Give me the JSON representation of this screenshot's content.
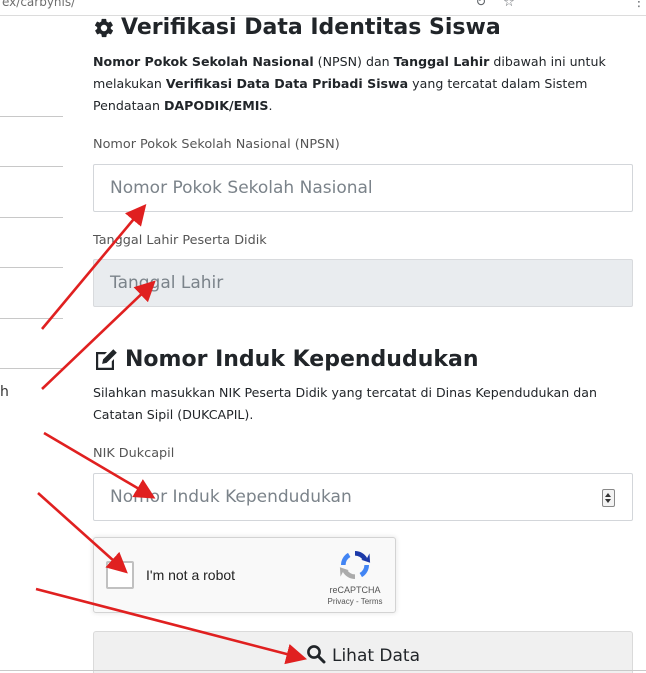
{
  "browser": {
    "url_fragment": "ex/carbynis/"
  },
  "sidebar": {
    "text_fragment": "h"
  },
  "verification": {
    "title": "Verifikasi Data Identitas Siswa",
    "title_icon": "gear-icon",
    "intro": {
      "npsn_bold": "Nomor Pokok Sekolah Nasional",
      "npsn_abbr": "(NPSN)",
      "and_text": "dan",
      "dob_bold": "Tanggal Lahir",
      "middle_text": "dibawah ini untuk melakukan",
      "verify_bold": "Verifikasi Data Data Pribadi Siswa",
      "tail_text": "yang tercatat dalam Sistem Pendataan",
      "system_bold": "DAPODIK/EMIS",
      "end": "."
    },
    "npsn_label": "Nomor Pokok Sekolah Nasional (NPSN)",
    "npsn_placeholder": "Nomor Pokok Sekolah Nasional",
    "dob_label": "Tanggal Lahir Peserta Didik",
    "dob_placeholder": "Tanggal Lahir"
  },
  "nik": {
    "title": "Nomor Induk Kependudukan",
    "title_icon": "edit-icon",
    "intro": "Silahkan masukkan NIK Peserta Didik yang tercatat di Dinas Kependudukan dan Catatan Sipil (DUKCAPIL).",
    "label": "NIK Dukcapil",
    "placeholder": "Nomor Induk Kependudukan"
  },
  "recaptcha": {
    "checkbox_label": "I'm not a robot",
    "brand": "reCAPTCHA",
    "privacy": "Privacy",
    "separator": "-",
    "terms": "Terms"
  },
  "submit": {
    "label": "Lihat Data",
    "icon": "search-icon"
  },
  "colors": {
    "annotation_arrow": "#e02020",
    "readonly_bg": "#e9ecef"
  }
}
